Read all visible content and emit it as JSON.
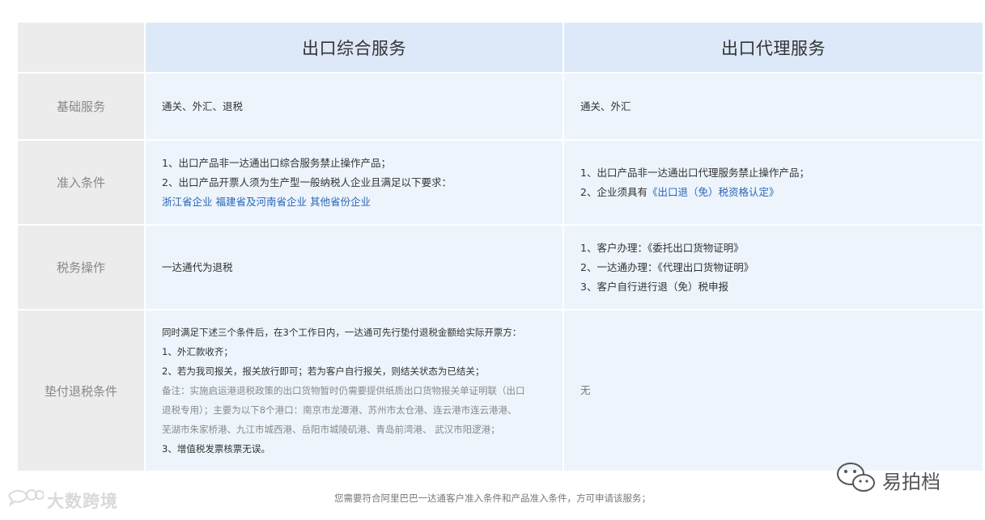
{
  "table": {
    "headers": [
      "出口综合服务",
      "出口代理服务"
    ],
    "rows": {
      "basic": {
        "label": "基础服务",
        "col1": "通关、外汇、退税",
        "col2": "通关、外汇"
      },
      "access": {
        "label": "准入条件",
        "col1": [
          "1、出口产品非一达通出口综合服务禁止操作产品；",
          "2、出口产品开票人须为生产型一般纳税人企业且满足以下要求："
        ],
        "col1_links": [
          "浙江省企业",
          "福建省及河南省企业",
          "其他省份企业"
        ],
        "col2_line1": "1、出口产品非一达通出口代理服务禁止操作产品；",
        "col2_line2_prefix": "2、企业须具有",
        "col2_line2_link": "《出口退（免）税资格认定》"
      },
      "tax": {
        "label": "税务操作",
        "col1": "一达通代为退税",
        "col2": [
          "1、客户办理：《委托出口货物证明》",
          "2、一达通办理：《代理出口货物证明》",
          "3、客户自行进行退（免）税申报"
        ]
      },
      "advance": {
        "label": "垫付退税条件",
        "col1": [
          "同时满足下述三个条件后，在3个工作日内，一达通可先行垫付退税金额给实际开票方：",
          "1、外汇款收齐；",
          "2、若为我司报关，报关放行即可；若为客户自行报关，则结关状态为已结关；"
        ],
        "col1_note": [
          "备注：实施启运港退税政策的出口货物暂时仍需要提供纸质出口货物报关单证明联（出口",
          "退税专用）；主要为以下8个港口：南京市龙潭港、苏州市太仓港、连云港市连云港港、",
          "芜湖市朱家桥港、九江市城西港、岳阳市城陵矶港、青岛前湾港、 武汉市阳逻港；"
        ],
        "col1_last": "3、增值税发票核票无误。",
        "col2": "无"
      }
    }
  },
  "footer": "您需要符合阿里巴巴一达通客户准入条件和产品准入条件，方可申请该服务；",
  "watermark_left": "大数跨境",
  "watermark_right": "易拍档",
  "icons": {
    "left_logo": "chat-logo-icon",
    "right_logo": "wechat-icon"
  },
  "colors": {
    "header_bg": "#dde9f8",
    "body_bg": "#edf4fc",
    "label_bg": "#ececec",
    "link": "#2a66b5"
  }
}
